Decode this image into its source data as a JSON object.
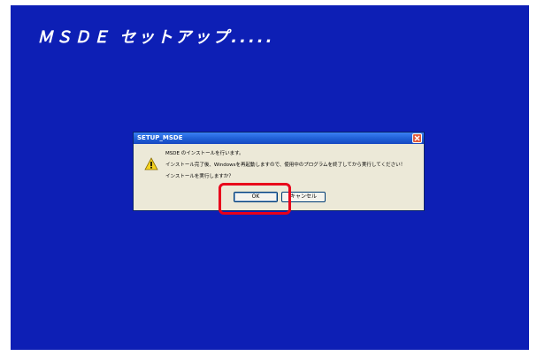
{
  "screen": {
    "title": "ＭＳＤＥ セットアップ.....",
    "background_color": "#0d1fb5"
  },
  "dialog": {
    "title": "SETUP_MSDE",
    "icon": "warning-icon",
    "close_icon": "close-icon",
    "messages": [
      "MSDE のインストールを行います。",
      "インストール完了後、Windowsを再起動しますので、使用中のプログラムを終了してから実行してください！",
      "インストールを実行しますか？"
    ],
    "ok_label": "OK",
    "cancel_label": "キャンセル"
  },
  "annotation": {
    "highlight_color": "#e8001b"
  }
}
